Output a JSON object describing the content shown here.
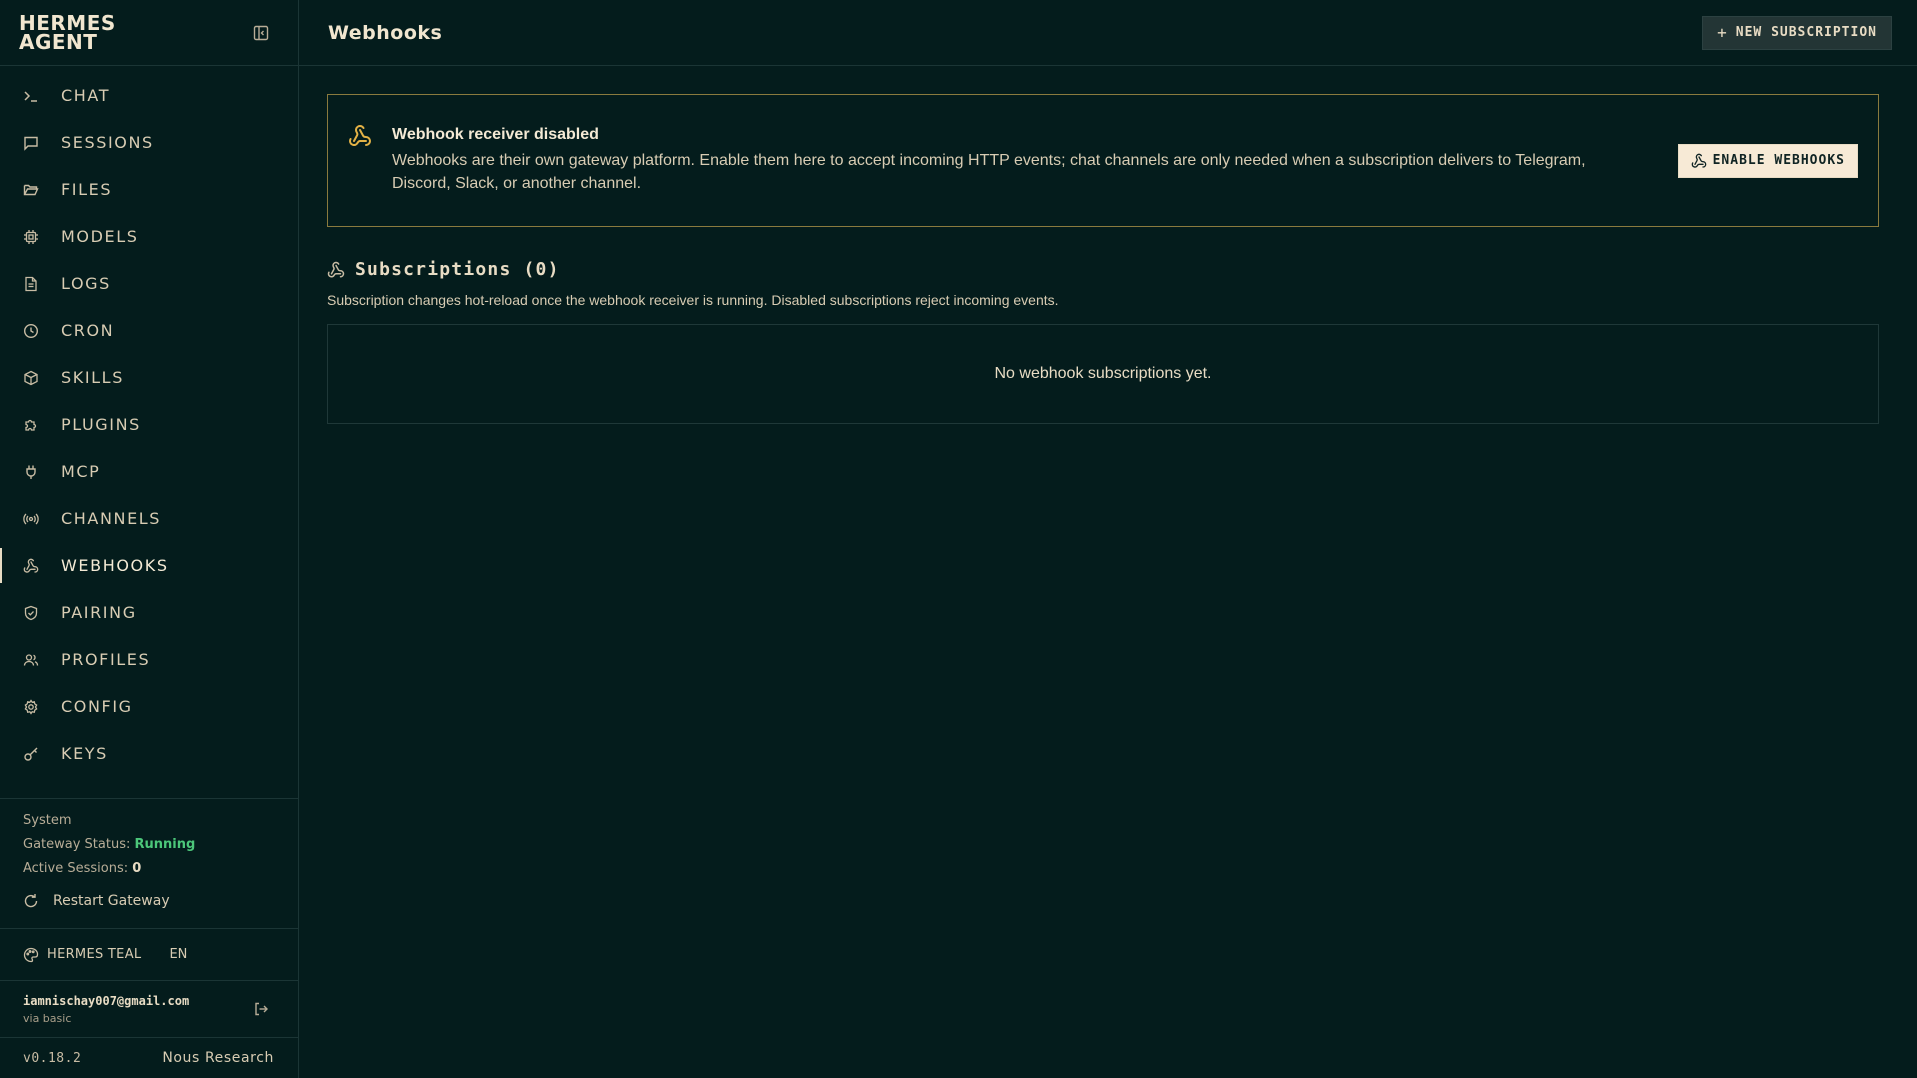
{
  "brand": {
    "title": "HERMES AGENT"
  },
  "sidebar": {
    "items": [
      {
        "label": "CHAT",
        "icon": "terminal-icon"
      },
      {
        "label": "SESSIONS",
        "icon": "message-square-icon"
      },
      {
        "label": "FILES",
        "icon": "folder-open-icon"
      },
      {
        "label": "MODELS",
        "icon": "cpu-icon"
      },
      {
        "label": "LOGS",
        "icon": "file-text-icon"
      },
      {
        "label": "CRON",
        "icon": "clock-icon"
      },
      {
        "label": "SKILLS",
        "icon": "package-icon"
      },
      {
        "label": "PLUGINS",
        "icon": "puzzle-icon"
      },
      {
        "label": "MCP",
        "icon": "plug-icon"
      },
      {
        "label": "CHANNELS",
        "icon": "radio-icon"
      },
      {
        "label": "WEBHOOKS",
        "icon": "webhook-icon",
        "active": true
      },
      {
        "label": "PAIRING",
        "icon": "shield-check-icon"
      },
      {
        "label": "PROFILES",
        "icon": "users-icon"
      },
      {
        "label": "CONFIG",
        "icon": "gear-icon"
      },
      {
        "label": "KEYS",
        "icon": "key-icon"
      }
    ]
  },
  "system": {
    "title": "System",
    "gateway_label": "Gateway Status:",
    "gateway_value": "Running",
    "sessions_label": "Active Sessions:",
    "sessions_value": "0",
    "restart_label": "Restart Gateway"
  },
  "theme": {
    "label": "HERMES TEAL",
    "lang": "EN"
  },
  "user": {
    "email": "iamnischay007@gmail.com",
    "auth": "via basic"
  },
  "footer": {
    "version": "v0.18.2",
    "vendor": "Nous Research"
  },
  "header": {
    "title": "Webhooks",
    "new_button": "NEW SUBSCRIPTION"
  },
  "alert": {
    "title": "Webhook receiver disabled",
    "body": "Webhooks are their own gateway platform. Enable them here to accept incoming HTTP events; chat channels are only needed when a subscription delivers to Telegram, Discord, Slack, or another channel.",
    "button": "ENABLE WEBHOOKS"
  },
  "subscriptions": {
    "title": "Subscriptions (0)",
    "description": "Subscription changes hot-reload once the webhook receiver is running. Disabled subscriptions reject incoming events.",
    "empty": "No webhook subscriptions yet."
  },
  "colors": {
    "background": "#041c1c",
    "text": "#e8dcc4",
    "running": "#4cc77a",
    "warning": "#e3b246",
    "alert_border": "#8a7a3e"
  }
}
